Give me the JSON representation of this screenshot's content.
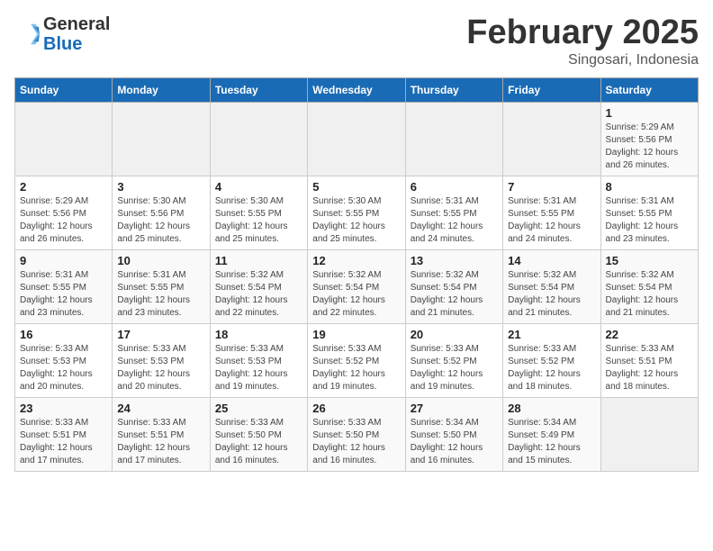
{
  "header": {
    "logo_line1": "General",
    "logo_line2": "Blue",
    "month": "February 2025",
    "location": "Singosari, Indonesia"
  },
  "days_of_week": [
    "Sunday",
    "Monday",
    "Tuesday",
    "Wednesday",
    "Thursday",
    "Friday",
    "Saturday"
  ],
  "weeks": [
    [
      {
        "day": "",
        "info": ""
      },
      {
        "day": "",
        "info": ""
      },
      {
        "day": "",
        "info": ""
      },
      {
        "day": "",
        "info": ""
      },
      {
        "day": "",
        "info": ""
      },
      {
        "day": "",
        "info": ""
      },
      {
        "day": "1",
        "info": "Sunrise: 5:29 AM\nSunset: 5:56 PM\nDaylight: 12 hours and 26 minutes."
      }
    ],
    [
      {
        "day": "2",
        "info": "Sunrise: 5:29 AM\nSunset: 5:56 PM\nDaylight: 12 hours and 26 minutes."
      },
      {
        "day": "3",
        "info": "Sunrise: 5:30 AM\nSunset: 5:56 PM\nDaylight: 12 hours and 25 minutes."
      },
      {
        "day": "4",
        "info": "Sunrise: 5:30 AM\nSunset: 5:55 PM\nDaylight: 12 hours and 25 minutes."
      },
      {
        "day": "5",
        "info": "Sunrise: 5:30 AM\nSunset: 5:55 PM\nDaylight: 12 hours and 25 minutes."
      },
      {
        "day": "6",
        "info": "Sunrise: 5:31 AM\nSunset: 5:55 PM\nDaylight: 12 hours and 24 minutes."
      },
      {
        "day": "7",
        "info": "Sunrise: 5:31 AM\nSunset: 5:55 PM\nDaylight: 12 hours and 24 minutes."
      },
      {
        "day": "8",
        "info": "Sunrise: 5:31 AM\nSunset: 5:55 PM\nDaylight: 12 hours and 23 minutes."
      }
    ],
    [
      {
        "day": "9",
        "info": "Sunrise: 5:31 AM\nSunset: 5:55 PM\nDaylight: 12 hours and 23 minutes."
      },
      {
        "day": "10",
        "info": "Sunrise: 5:31 AM\nSunset: 5:55 PM\nDaylight: 12 hours and 23 minutes."
      },
      {
        "day": "11",
        "info": "Sunrise: 5:32 AM\nSunset: 5:54 PM\nDaylight: 12 hours and 22 minutes."
      },
      {
        "day": "12",
        "info": "Sunrise: 5:32 AM\nSunset: 5:54 PM\nDaylight: 12 hours and 22 minutes."
      },
      {
        "day": "13",
        "info": "Sunrise: 5:32 AM\nSunset: 5:54 PM\nDaylight: 12 hours and 21 minutes."
      },
      {
        "day": "14",
        "info": "Sunrise: 5:32 AM\nSunset: 5:54 PM\nDaylight: 12 hours and 21 minutes."
      },
      {
        "day": "15",
        "info": "Sunrise: 5:32 AM\nSunset: 5:54 PM\nDaylight: 12 hours and 21 minutes."
      }
    ],
    [
      {
        "day": "16",
        "info": "Sunrise: 5:33 AM\nSunset: 5:53 PM\nDaylight: 12 hours and 20 minutes."
      },
      {
        "day": "17",
        "info": "Sunrise: 5:33 AM\nSunset: 5:53 PM\nDaylight: 12 hours and 20 minutes."
      },
      {
        "day": "18",
        "info": "Sunrise: 5:33 AM\nSunset: 5:53 PM\nDaylight: 12 hours and 19 minutes."
      },
      {
        "day": "19",
        "info": "Sunrise: 5:33 AM\nSunset: 5:52 PM\nDaylight: 12 hours and 19 minutes."
      },
      {
        "day": "20",
        "info": "Sunrise: 5:33 AM\nSunset: 5:52 PM\nDaylight: 12 hours and 19 minutes."
      },
      {
        "day": "21",
        "info": "Sunrise: 5:33 AM\nSunset: 5:52 PM\nDaylight: 12 hours and 18 minutes."
      },
      {
        "day": "22",
        "info": "Sunrise: 5:33 AM\nSunset: 5:51 PM\nDaylight: 12 hours and 18 minutes."
      }
    ],
    [
      {
        "day": "23",
        "info": "Sunrise: 5:33 AM\nSunset: 5:51 PM\nDaylight: 12 hours and 17 minutes."
      },
      {
        "day": "24",
        "info": "Sunrise: 5:33 AM\nSunset: 5:51 PM\nDaylight: 12 hours and 17 minutes."
      },
      {
        "day": "25",
        "info": "Sunrise: 5:33 AM\nSunset: 5:50 PM\nDaylight: 12 hours and 16 minutes."
      },
      {
        "day": "26",
        "info": "Sunrise: 5:33 AM\nSunset: 5:50 PM\nDaylight: 12 hours and 16 minutes."
      },
      {
        "day": "27",
        "info": "Sunrise: 5:34 AM\nSunset: 5:50 PM\nDaylight: 12 hours and 16 minutes."
      },
      {
        "day": "28",
        "info": "Sunrise: 5:34 AM\nSunset: 5:49 PM\nDaylight: 12 hours and 15 minutes."
      },
      {
        "day": "",
        "info": ""
      }
    ]
  ]
}
